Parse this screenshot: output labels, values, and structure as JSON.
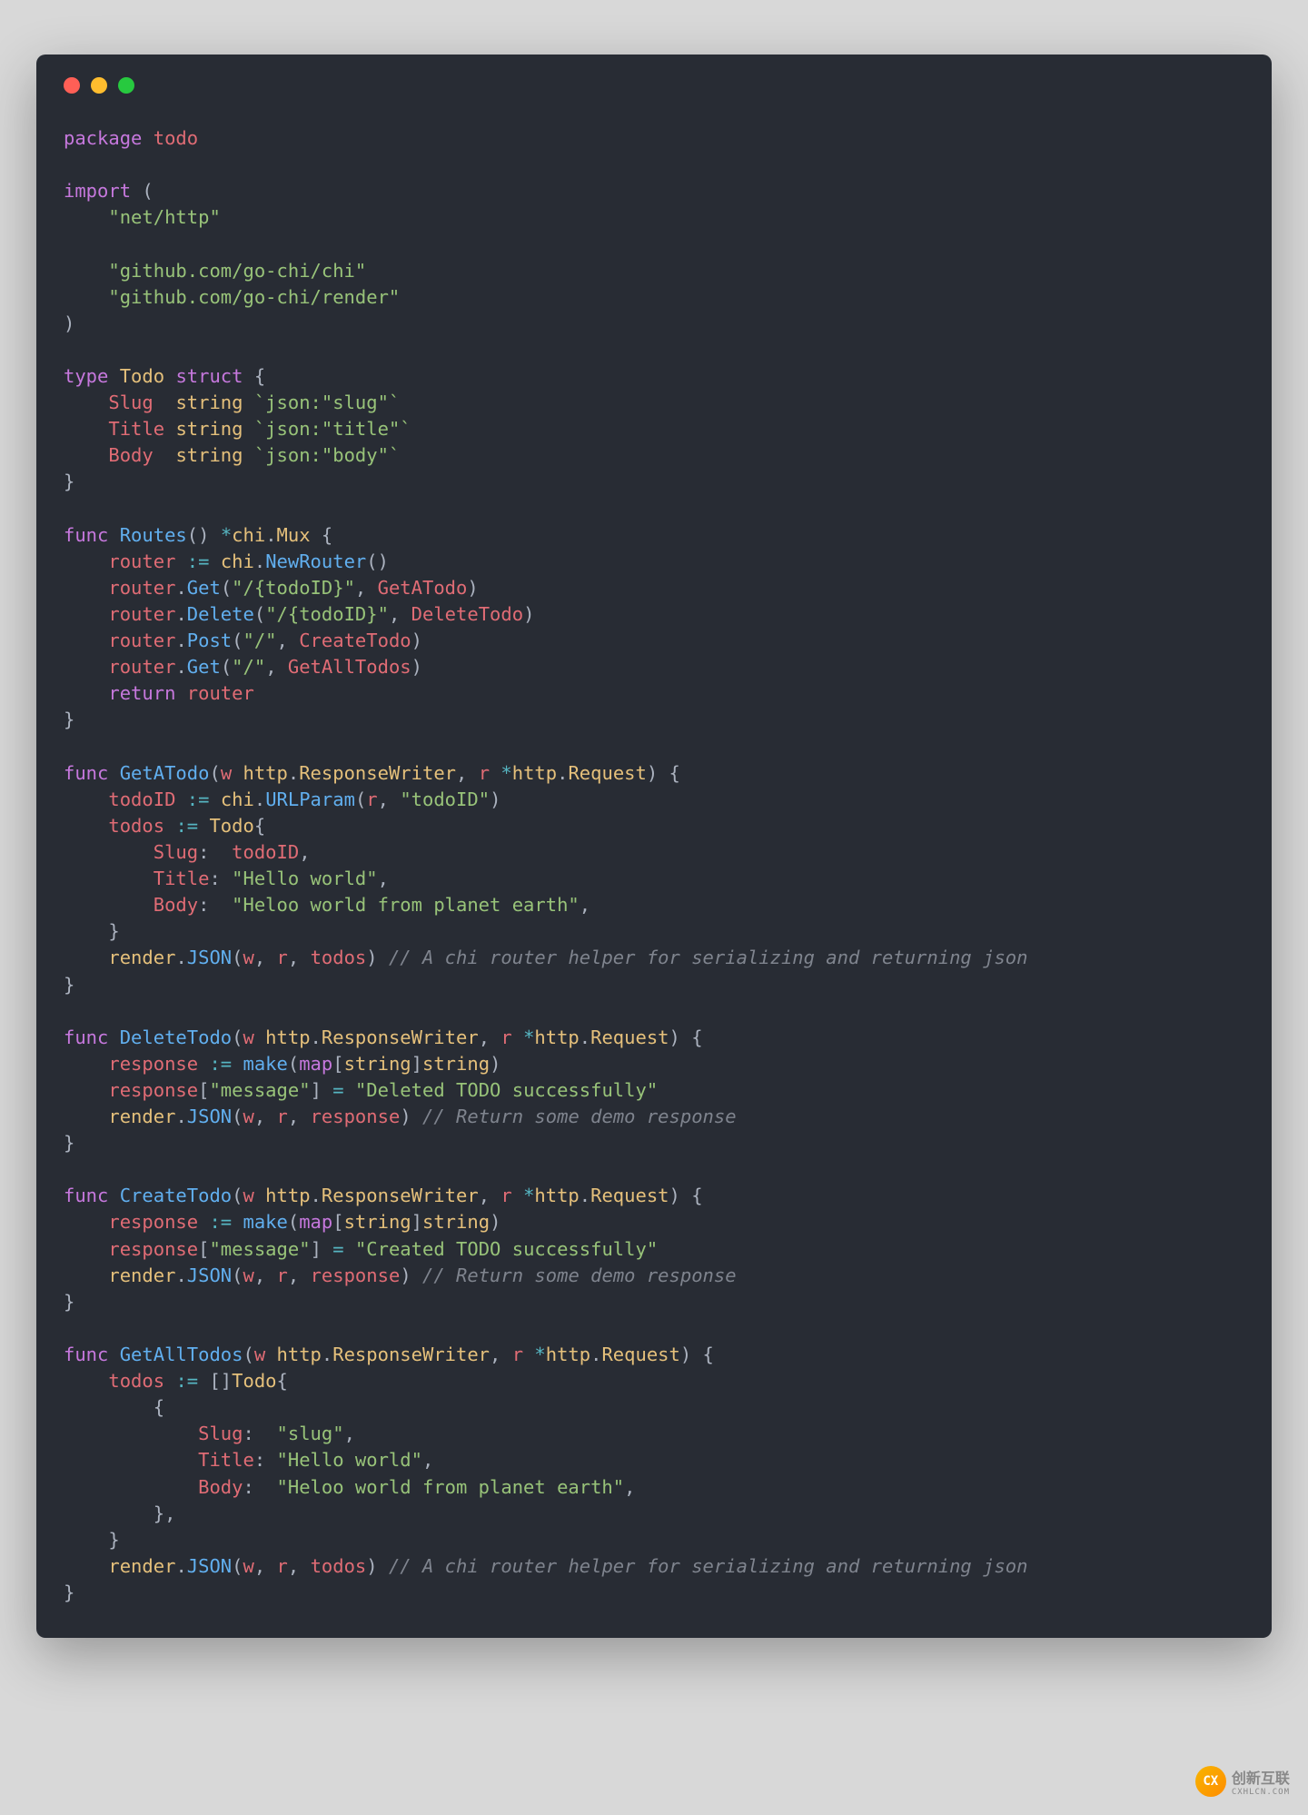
{
  "window": {
    "dots": [
      "red",
      "yellow",
      "green"
    ]
  },
  "code": {
    "package_kw": "package",
    "package_name": "todo",
    "import_kw": "import",
    "imports": {
      "net_http": "\"net/http\"",
      "chi": "\"github.com/go-chi/chi\"",
      "render": "\"github.com/go-chi/render\""
    },
    "type_kw": "type",
    "struct_kw": "struct",
    "todo_type": "Todo",
    "fields": {
      "slug_name": "Slug",
      "title_name": "Title",
      "body_name": "Body",
      "string_type": "string",
      "slug_tag": "`json:\"slug\"`",
      "title_tag": "`json:\"title\"`",
      "body_tag": "`json:\"body\"`"
    },
    "func_kw": "func",
    "return_kw": "return",
    "routes": {
      "name": "Routes",
      "ret_type_pkg": "chi",
      "ret_type": "Mux",
      "router_var": "router",
      "new_router_pkg": "chi",
      "new_router_fn": "NewRouter",
      "get_fn": "Get",
      "delete_fn": "Delete",
      "post_fn": "Post",
      "path_todoid": "\"/{todoID}\"",
      "path_root": "\"/\"",
      "handler_get_a": "GetATodo",
      "handler_delete": "DeleteTodo",
      "handler_create": "CreateTodo",
      "handler_get_all": "GetAllTodos"
    },
    "get_a_todo": {
      "name": "GetATodo",
      "w": "w",
      "r": "r",
      "http_pkg": "http",
      "response_writer": "ResponseWriter",
      "request": "Request",
      "todoid_var": "todoID",
      "url_param_pkg": "chi",
      "url_param_fn": "URLParam",
      "url_param_arg": "\"todoID\"",
      "todos_var": "todos",
      "slug_field": "Slug",
      "title_field": "Title",
      "body_field": "Body",
      "title_val": "\"Hello world\"",
      "body_val": "\"Heloo world from planet earth\"",
      "render_pkg": "render",
      "json_fn": "JSON",
      "comment": "// A chi router helper for serializing and returning json"
    },
    "delete_todo": {
      "name": "DeleteTodo",
      "response_var": "response",
      "make_fn": "make",
      "map_kw": "map",
      "string_type": "string",
      "message_key": "\"message\"",
      "message_val": "\"Deleted TODO successfully\"",
      "comment": "// Return some demo response"
    },
    "create_todo": {
      "name": "CreateTodo",
      "message_val": "\"Created TODO successfully\"",
      "comment": "// Return some demo response"
    },
    "get_all_todos": {
      "name": "GetAllTodos",
      "slug_val": "\"slug\"",
      "title_val": "\"Hello world\"",
      "body_val": "\"Heloo world from planet earth\"",
      "comment": "// A chi router helper for serializing and returning json"
    }
  },
  "watermark": {
    "text": "创新互联",
    "subtext": "CXHLCN.COM"
  }
}
